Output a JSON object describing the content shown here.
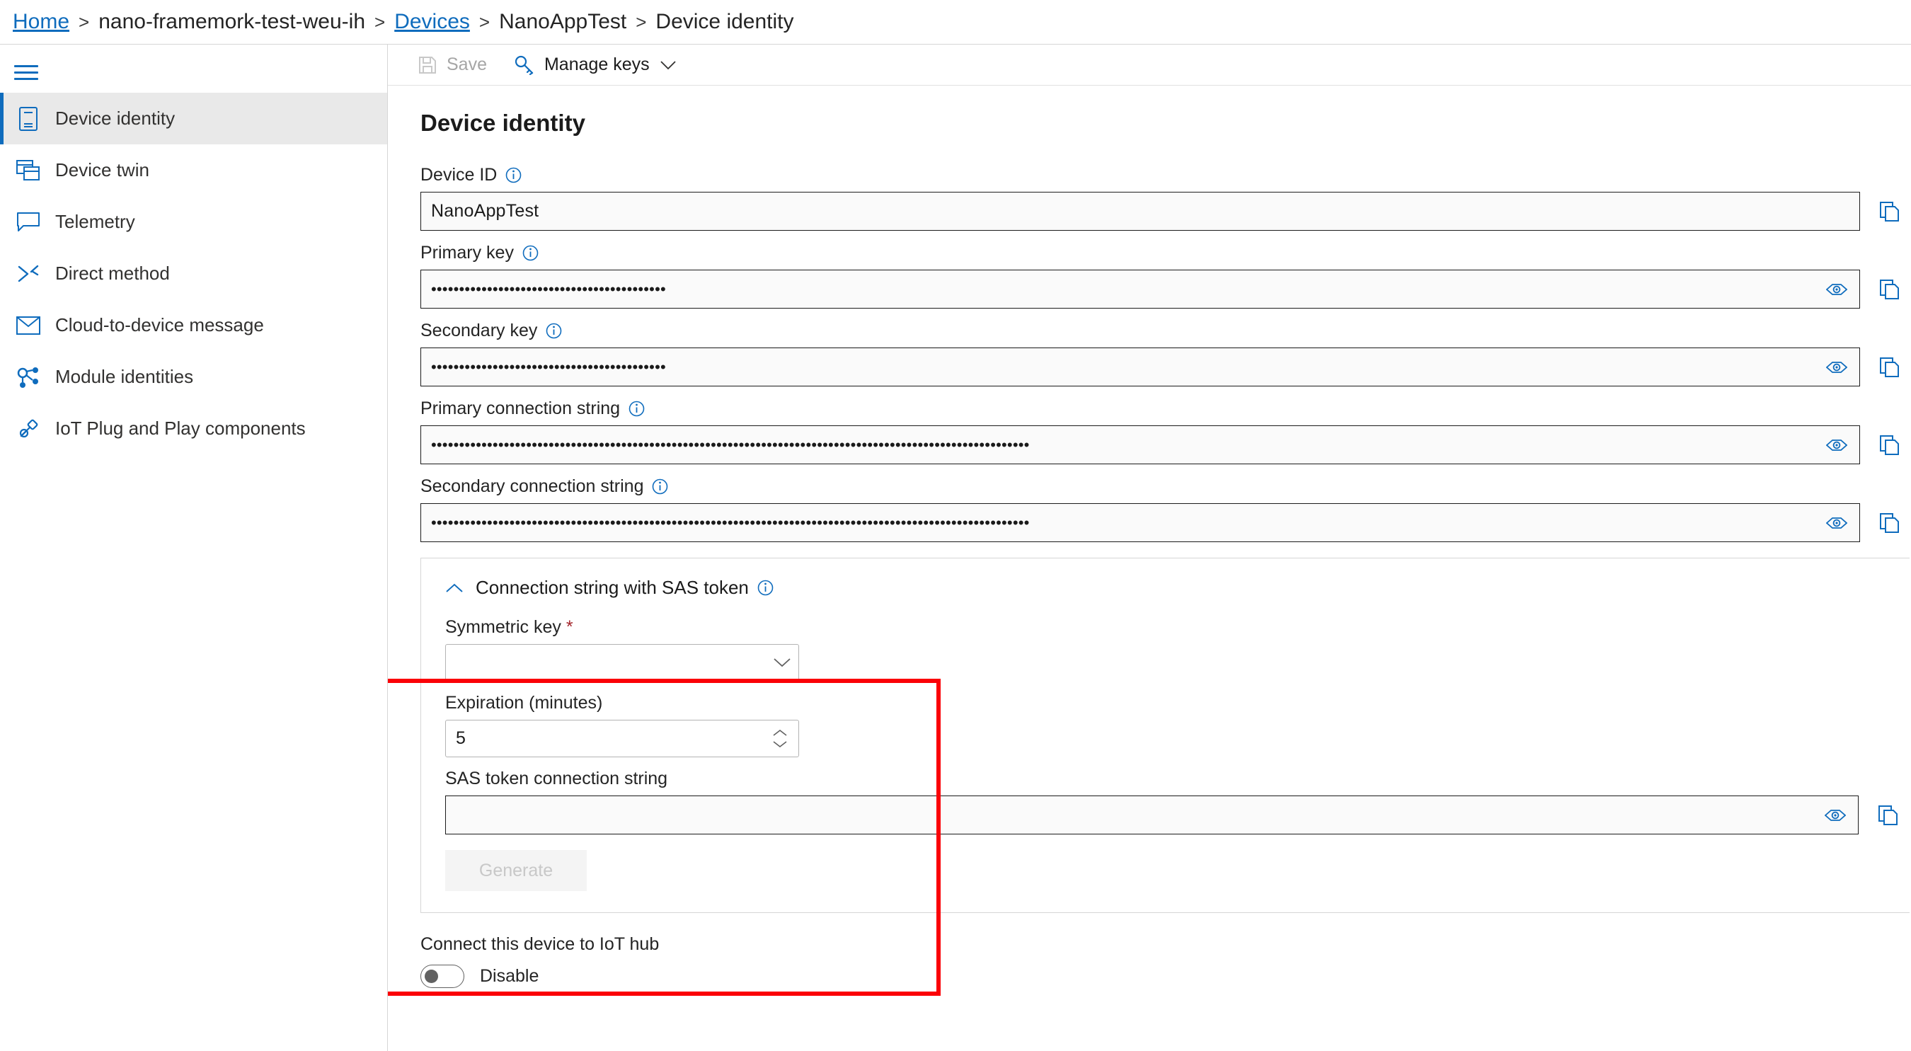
{
  "breadcrumb": {
    "items": [
      {
        "label": "Home",
        "link": true
      },
      {
        "label": "nano-framemork-test-weu-ih",
        "link": false
      },
      {
        "label": "Devices",
        "link": true
      },
      {
        "label": "NanoAppTest",
        "link": false
      },
      {
        "label": "Device identity",
        "link": false
      }
    ],
    "separator": ">"
  },
  "sidebar": {
    "menu_icon": "hamburger-icon",
    "items": [
      {
        "label": "Device identity",
        "icon": "device-icon",
        "active": true
      },
      {
        "label": "Device twin",
        "icon": "windows-stack-icon",
        "active": false
      },
      {
        "label": "Telemetry",
        "icon": "chat-bubble-icon",
        "active": false
      },
      {
        "label": "Direct method",
        "icon": "arrows-cross-icon",
        "active": false
      },
      {
        "label": "Cloud-to-device message",
        "icon": "envelope-icon",
        "active": false
      },
      {
        "label": "Module identities",
        "icon": "nodes-icon",
        "active": false
      },
      {
        "label": "IoT Plug and Play components",
        "icon": "plug-icon",
        "active": false
      }
    ]
  },
  "toolbar": {
    "save_label": "Save",
    "save_icon": "save-disk-icon",
    "save_disabled": true,
    "manage_keys_label": "Manage keys",
    "manage_keys_icon": "key-icon",
    "manage_keys_chevron": "chevron-down-icon"
  },
  "main": {
    "title": "Device identity",
    "fields": [
      {
        "label": "Device ID",
        "info_icon": "info-circle-icon",
        "value": "NanoAppTest",
        "masked": false,
        "has_eye": false,
        "has_copy": true,
        "copy_icon": "copy-pages-icon"
      },
      {
        "label": "Primary key",
        "info_icon": "info-circle-icon",
        "value": "••••••••••••••••••••••••••••••••••••••••••",
        "masked": true,
        "has_eye": true,
        "eye_icon": "eye-icon",
        "has_copy": true,
        "copy_icon": "copy-pages-icon"
      },
      {
        "label": "Secondary key",
        "info_icon": "info-circle-icon",
        "value": "••••••••••••••••••••••••••••••••••••••••••",
        "masked": true,
        "has_eye": true,
        "eye_icon": "eye-icon",
        "has_copy": true,
        "copy_icon": "copy-pages-icon"
      },
      {
        "label": "Primary connection string",
        "info_icon": "info-circle-icon",
        "value": "•••••••••••••••••••••••••••••••••••••••••••••••••••••••••••••••••••••••••••••••••••••••••••••••••••••••••••",
        "masked": true,
        "has_eye": true,
        "eye_icon": "eye-icon",
        "has_copy": true,
        "copy_icon": "copy-pages-icon"
      },
      {
        "label": "Secondary connection string",
        "info_icon": "info-circle-icon",
        "value": "•••••••••••••••••••••••••••••••••••••••••••••••••••••••••••••••••••••••••••••••••••••••••••••••••••••••••••",
        "masked": true,
        "has_eye": true,
        "eye_icon": "eye-icon",
        "has_copy": true,
        "copy_icon": "copy-pages-icon"
      }
    ],
    "sas_panel": {
      "header": "Connection string with SAS token",
      "header_info_icon": "info-circle-icon",
      "expand_icon": "chevron-up-icon",
      "expanded": true,
      "symmetric_key": {
        "label": "Symmetric key",
        "required_marker": "*",
        "value": "",
        "chevron_icon": "chevron-down-icon"
      },
      "expiration": {
        "label": "Expiration (minutes)",
        "value": "5",
        "spinner_up_icon": "chevron-up-icon",
        "spinner_down_icon": "chevron-down-icon"
      },
      "sas_token": {
        "label": "SAS token connection string",
        "value": "",
        "eye_icon": "eye-icon",
        "copy_icon": "copy-pages-icon"
      },
      "generate_button": {
        "label": "Generate",
        "disabled": true
      }
    },
    "connect": {
      "label": "Connect this device to IoT hub",
      "toggle_state": "off",
      "toggle_text": "Disable"
    },
    "highlight_color": "#fb0007"
  }
}
